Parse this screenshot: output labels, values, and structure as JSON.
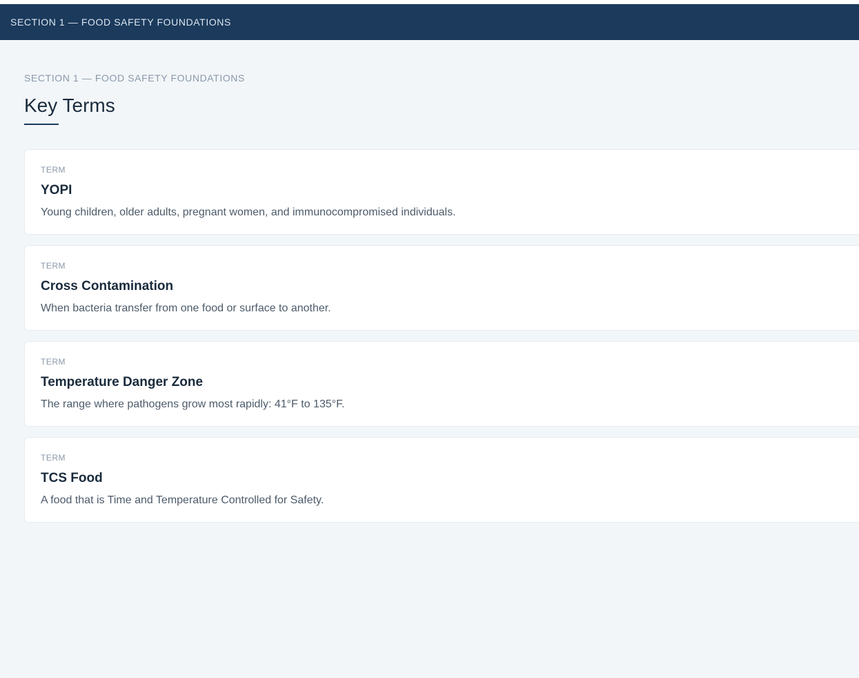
{
  "header": {
    "title": "SECTION 1 — FOOD SAFETY FOUNDATIONS"
  },
  "main": {
    "eyebrow": "SECTION 1 — FOOD SAFETY FOUNDATIONS",
    "title": "Key Terms",
    "cards": [
      {
        "kicker": "TERM",
        "title": "YOPI",
        "description": "Young children, older adults, pregnant women, and immunocompromised individuals."
      },
      {
        "kicker": "TERM",
        "title": "Cross Contamination",
        "description": "When bacteria transfer from one food or surface to another."
      },
      {
        "kicker": "TERM",
        "title": "Temperature Danger Zone",
        "description": "The range where pathogens grow most rapidly: 41°F to 135°F."
      },
      {
        "kicker": "TERM",
        "title": "TCS Food",
        "description": "A food that is Time and Temperature Controlled for Safety."
      }
    ]
  },
  "colors": {
    "header_bg": "#1b3a5c",
    "page_bg": "#f2f6f9",
    "card_bg": "#ffffff",
    "accent": "#1b3a5c"
  }
}
